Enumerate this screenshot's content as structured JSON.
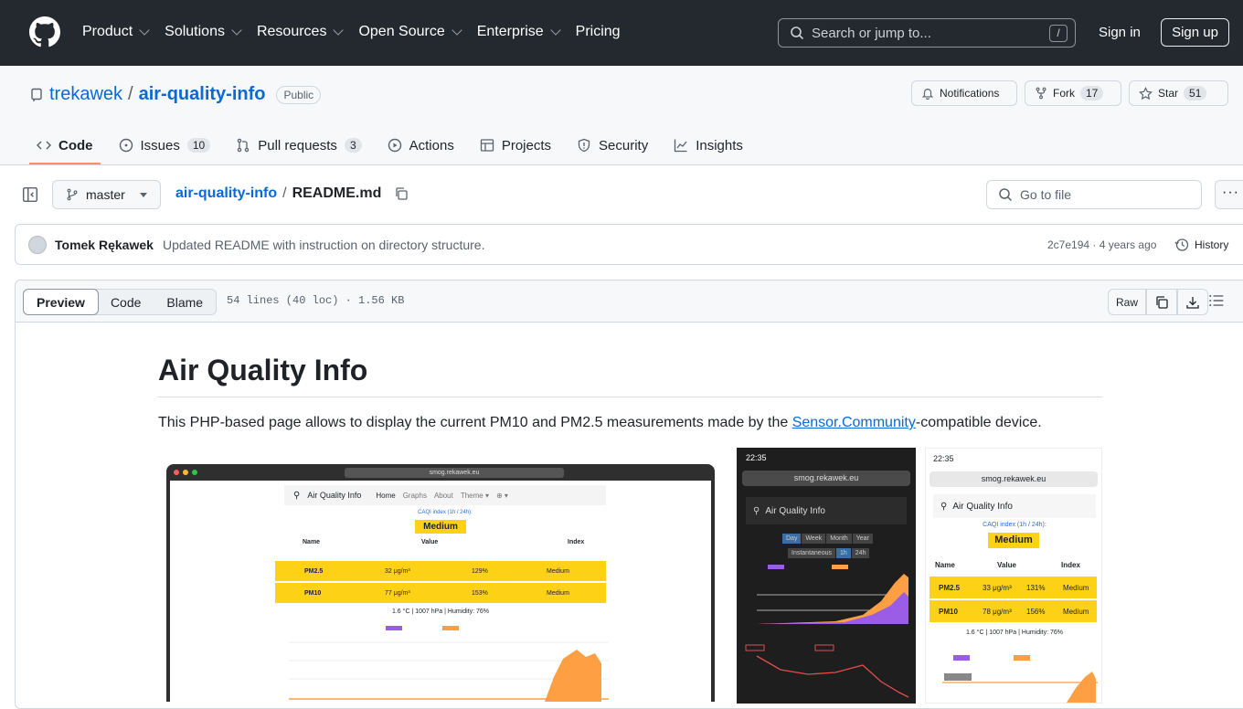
{
  "header": {
    "nav": [
      "Product",
      "Solutions",
      "Resources",
      "Open Source",
      "Enterprise",
      "Pricing"
    ],
    "search_placeholder": "Search or jump to...",
    "search_shortcut": "/",
    "sign_in": "Sign in",
    "sign_up": "Sign up"
  },
  "repo": {
    "owner": "trekawek",
    "separator": "/",
    "name": "air-quality-info",
    "visibility": "Public",
    "notifications": "Notifications",
    "fork_label": "Fork",
    "fork_count": "17",
    "star_label": "Star",
    "star_count": "51"
  },
  "tabs": [
    {
      "label": "Code",
      "count": ""
    },
    {
      "label": "Issues",
      "count": "10"
    },
    {
      "label": "Pull requests",
      "count": "3"
    },
    {
      "label": "Actions",
      "count": ""
    },
    {
      "label": "Projects",
      "count": ""
    },
    {
      "label": "Security",
      "count": ""
    },
    {
      "label": "Insights",
      "count": ""
    }
  ],
  "file": {
    "branch": "master",
    "breadcrumb_repo": "air-quality-info",
    "breadcrumb_sep": "/",
    "breadcrumb_file": "README.md",
    "goto_placeholder": "Go to file",
    "more": "···"
  },
  "commit": {
    "author": "Tomek Rękawek",
    "message": "Updated README with instruction on directory structure.",
    "meta": "2c7e194 · 4 years ago",
    "history": "History"
  },
  "viewer": {
    "modes": [
      "Preview",
      "Code",
      "Blame"
    ],
    "info": "54 lines (40 loc) · 1.56 KB",
    "raw": "Raw"
  },
  "readme": {
    "title": "Air Quality Info",
    "intro_before": "This PHP-based page allows to display the current PM10 and PM2.5 measurements made by the ",
    "intro_link": "Sensor.Community",
    "intro_after": "-compatible device."
  },
  "screenshots": {
    "laptop_url": "smog.rekawek.eu",
    "phone_url": "smog.rekawek.eu",
    "app_name": "Air Quality Info",
    "menu": [
      "Home",
      "Graphs",
      "About",
      "Theme ▾",
      "⊕ ▾"
    ],
    "caqi_label": "CAQI index (1h / 24h):",
    "level": "Medium",
    "columns": [
      "Name",
      "Value",
      "Index"
    ],
    "rows_laptop": [
      {
        "name": "PM2.5",
        "value": "32 μg/m³",
        "pct": "129%",
        "index": "Medium"
      },
      {
        "name": "PM10",
        "value": "77 μg/m³",
        "pct": "153%",
        "index": "Medium"
      }
    ],
    "rows_phone": [
      {
        "name": "PM2.5",
        "value": "33 μg/m³",
        "pct": "131%",
        "index": "Medium"
      },
      {
        "name": "PM10",
        "value": "78 μg/m³",
        "pct": "156%",
        "index": "Medium"
      }
    ],
    "weather_laptop": "1.6 °C | 1007 hPa | Humidity: 76%",
    "weather_phone": "1.6 °C | 1007 hPa | Humidity: 76%",
    "time": "22:35",
    "ranges": [
      "Day",
      "Week",
      "Month",
      "Year"
    ],
    "subranges": [
      "Instantaneous",
      "1h",
      "24h"
    ],
    "colors": {
      "yellow": "#fcd116",
      "purple": "#9b5de5",
      "orange": "#ff9f43"
    }
  }
}
